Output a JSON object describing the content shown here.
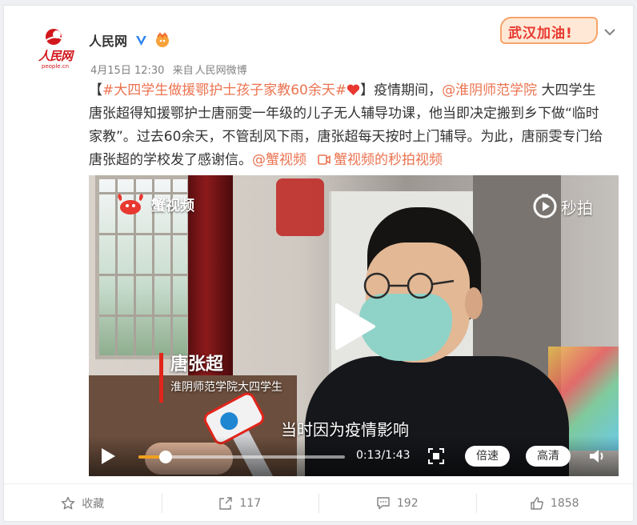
{
  "post": {
    "author": "人民网",
    "avatar_text": "人民网",
    "avatar_domain": "people.cn",
    "date": "4月15日 12:30",
    "source_prefix": "来自",
    "source": "人民网微博",
    "banner": "武汉加油!",
    "text": {
      "bracket_open": "【",
      "topic": "#大四学生做援鄂护士孩子家教60余天#",
      "bracket_close": "】",
      "part1": "疫情期间，",
      "mention1": "@淮阴师范学院",
      "part2": " 大四学生唐张超得知援鄂护士唐丽雯一年级的儿子无人辅导功课，他当即决定搬到乡下做“临时家教”。过去60余天，不管刮风下雨，唐张超每天按时上门辅导。为此，唐丽雯专门给唐张超的学校发了感谢信。",
      "mention2": "@蟹视频",
      "video_link": "蟹视频的秒拍视频"
    }
  },
  "video": {
    "channel_name": "蟹视频",
    "source_name": "秒拍",
    "caption_name": "唐张超",
    "caption_desc": "淮阴师范学院大四学生",
    "subtitle": "当时因为疫情影响",
    "time": "0:13/1:43",
    "progress_fraction": 0.13,
    "speed_label": "倍速",
    "quality_label": "高清"
  },
  "footer": {
    "favorite_label": "收藏",
    "share_count": "117",
    "comment_count": "192",
    "like_count": "1858"
  },
  "colors": {
    "link": "#eb7350",
    "brand_red": "#d1171c",
    "progress": "#f0a020"
  }
}
